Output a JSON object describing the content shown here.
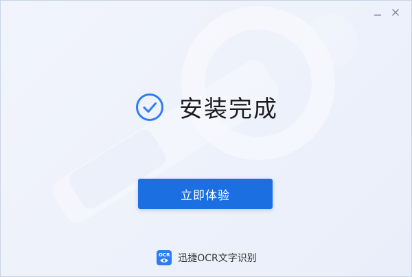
{
  "window": {
    "minimize_icon": "minimize-icon",
    "close_icon": "close-icon"
  },
  "status": {
    "icon": "check-circle-icon",
    "text": "安装完成"
  },
  "actions": {
    "primary_label": "立即体验"
  },
  "brand": {
    "logo_text": "OCR",
    "name": "迅捷OCR文字识别"
  },
  "colors": {
    "accent": "#1b6fe1",
    "check_icon": "#2f7df3",
    "background": "#eef2fb"
  }
}
